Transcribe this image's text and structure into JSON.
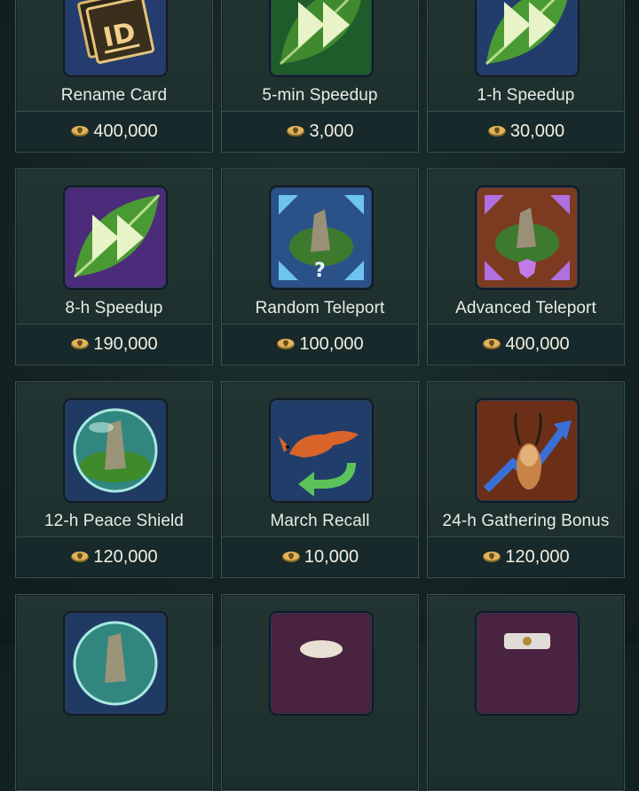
{
  "items": [
    {
      "name": "Rename Card",
      "price": "400,000",
      "icon": "rename-card-icon",
      "bg": "#233a6b"
    },
    {
      "name": "5-min Speedup",
      "price": "3,000",
      "icon": "speedup-5min-icon",
      "bg": "#1f5a2a"
    },
    {
      "name": "1-h Speedup",
      "price": "30,000",
      "icon": "speedup-1h-icon",
      "bg": "#203a6a"
    },
    {
      "name": "8-h Speedup",
      "price": "190,000",
      "icon": "speedup-8h-icon",
      "bg": "#4a2a78"
    },
    {
      "name": "Random Teleport",
      "price": "100,000",
      "icon": "random-teleport-icon",
      "bg": "#2a4f86"
    },
    {
      "name": "Advanced Teleport",
      "price": "400,000",
      "icon": "advanced-teleport-icon",
      "bg": "#7a3a20"
    },
    {
      "name": "12-h Peace Shield",
      "price": "120,000",
      "icon": "peace-shield-icon",
      "bg": "#1f3b63"
    },
    {
      "name": "March Recall",
      "price": "10,000",
      "icon": "march-recall-icon",
      "bg": "#213e6a"
    },
    {
      "name": "24-h Gathering Bonus",
      "price": "120,000",
      "icon": "gathering-bonus-icon",
      "bg": "#6b2f18"
    }
  ],
  "currency_icon": "coin-skull-icon",
  "colors": {
    "accent_gold": "#e1b45a",
    "card_bg": "#1f3230",
    "border": "#3b5350"
  }
}
